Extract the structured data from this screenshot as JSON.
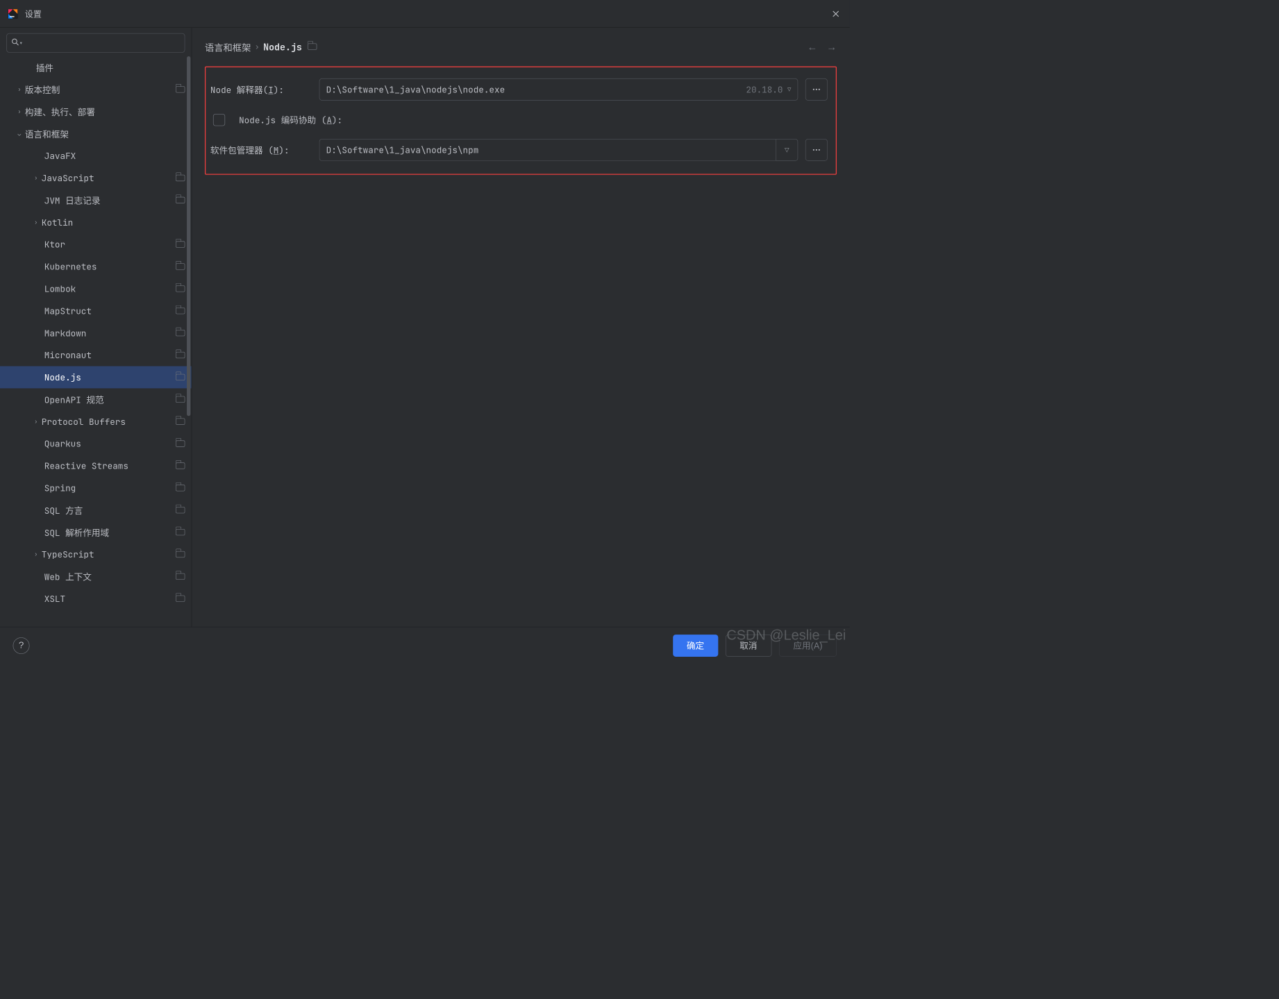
{
  "window": {
    "title": "设置"
  },
  "search": {
    "placeholder": ""
  },
  "sidebar": {
    "items": [
      {
        "label": "插件",
        "level": 0,
        "arrow": "",
        "project": false
      },
      {
        "label": "版本控制",
        "level": 0,
        "arrow": "right",
        "project": true
      },
      {
        "label": "构建、执行、部署",
        "level": 0,
        "arrow": "right",
        "project": false
      },
      {
        "label": "语言和框架",
        "level": 0,
        "arrow": "down",
        "project": false
      },
      {
        "label": "JavaFX",
        "level": 2,
        "arrow": "",
        "project": false
      },
      {
        "label": "JavaScript",
        "level": 1,
        "arrow": "right",
        "project": true
      },
      {
        "label": "JVM 日志记录",
        "level": 2,
        "arrow": "",
        "project": true
      },
      {
        "label": "Kotlin",
        "level": 1,
        "arrow": "right",
        "project": false
      },
      {
        "label": "Ktor",
        "level": 2,
        "arrow": "",
        "project": true
      },
      {
        "label": "Kubernetes",
        "level": 2,
        "arrow": "",
        "project": true
      },
      {
        "label": "Lombok",
        "level": 2,
        "arrow": "",
        "project": true
      },
      {
        "label": "MapStruct",
        "level": 2,
        "arrow": "",
        "project": true
      },
      {
        "label": "Markdown",
        "level": 2,
        "arrow": "",
        "project": true
      },
      {
        "label": "Micronaut",
        "level": 2,
        "arrow": "",
        "project": true
      },
      {
        "label": "Node.js",
        "level": 2,
        "arrow": "",
        "project": true,
        "selected": true
      },
      {
        "label": "OpenAPI 规范",
        "level": 2,
        "arrow": "",
        "project": true
      },
      {
        "label": "Protocol Buffers",
        "level": 1,
        "arrow": "right",
        "project": true
      },
      {
        "label": "Quarkus",
        "level": 2,
        "arrow": "",
        "project": true
      },
      {
        "label": "Reactive Streams",
        "level": 2,
        "arrow": "",
        "project": true
      },
      {
        "label": "Spring",
        "level": 2,
        "arrow": "",
        "project": true
      },
      {
        "label": "SQL 方言",
        "level": 2,
        "arrow": "",
        "project": true
      },
      {
        "label": "SQL 解析作用域",
        "level": 2,
        "arrow": "",
        "project": true
      },
      {
        "label": "TypeScript",
        "level": 1,
        "arrow": "right",
        "project": true
      },
      {
        "label": "Web 上下文",
        "level": 2,
        "arrow": "",
        "project": true
      },
      {
        "label": "XSLT",
        "level": 2,
        "arrow": "",
        "project": true
      }
    ]
  },
  "breadcrumb": {
    "root": "语言和框架",
    "leaf": "Node.js"
  },
  "form": {
    "interpreter": {
      "label_prefix": "Node 解释器(",
      "mnemonic": "I",
      "label_suffix": "):",
      "value": "D:\\Software\\1_java\\nodejs\\node.exe",
      "version": "20.18.0"
    },
    "coding_assist": {
      "label_prefix": "Node.js 编码协助 (",
      "mnemonic": "A",
      "label_suffix": "):",
      "checked": false
    },
    "package_manager": {
      "label_prefix": "软件包管理器 (",
      "mnemonic": "M",
      "label_suffix": "):",
      "value": "D:\\Software\\1_java\\nodejs\\npm"
    }
  },
  "footer": {
    "ok": "确定",
    "cancel": "取消",
    "apply": "应用(A)"
  },
  "watermark": "CSDN @Leslie_Lei"
}
